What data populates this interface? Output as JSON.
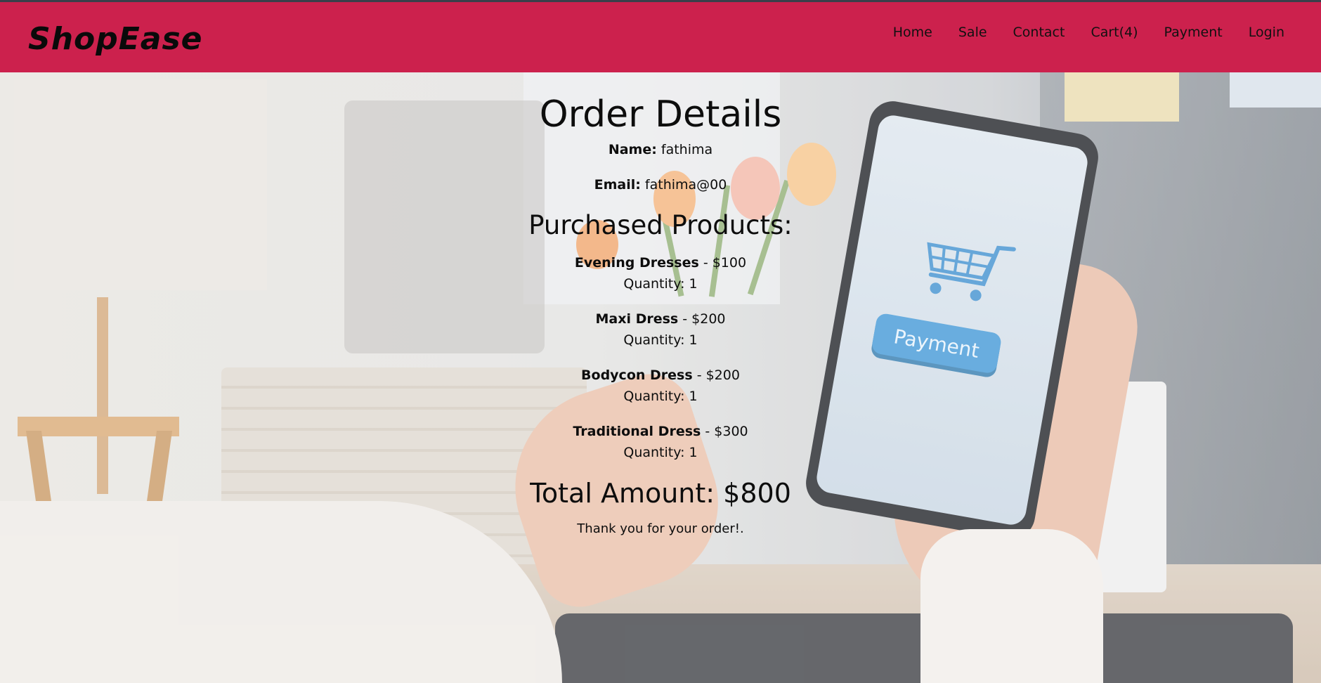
{
  "brand": "ShopEase",
  "nav": {
    "home": "Home",
    "sale": "Sale",
    "contact": "Contact",
    "cart": "Cart(4)",
    "payment": "Payment",
    "login": "Login"
  },
  "order": {
    "title": "Order Details",
    "name_label": "Name:",
    "name_value": "fathima",
    "email_label": "Email:",
    "email_value": "fathima@00",
    "products_title": "Purchased Products:",
    "products": [
      {
        "name": "Evening Dresses",
        "price": " - $100",
        "quantity": "Quantity: 1"
      },
      {
        "name": "Maxi Dress",
        "price": " - $200",
        "quantity": "Quantity: 1"
      },
      {
        "name": "Bodycon Dress",
        "price": " - $200",
        "quantity": "Quantity: 1"
      },
      {
        "name": "Traditional Dress",
        "price": " - $300",
        "quantity": "Quantity: 1"
      }
    ],
    "total": "Total Amount: $800",
    "thanks": "Thank you for your order!."
  },
  "hero": {
    "phone_button": "Payment"
  },
  "colors": {
    "navbar": "#cc214d",
    "text": "#0d0d0d",
    "phone_button": "#3f97d6"
  }
}
